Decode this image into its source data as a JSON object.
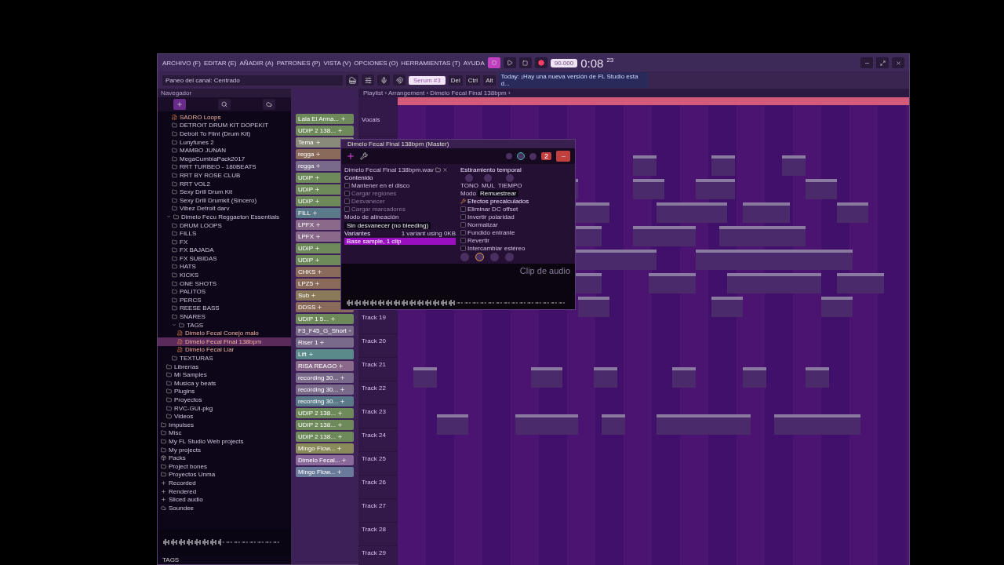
{
  "window": {
    "menu": [
      "ARCHIVO (F)",
      "EDITAR (E)",
      "AÑADIR (A)",
      "PATRONES (P)",
      "VISTA (V)",
      "OPCIONES (O)",
      "HERRAMIENTAS (T)",
      "AYUDA"
    ],
    "recording": true,
    "tempo": "90.000",
    "time": "0:08",
    "time_sub": "23",
    "hint": "Paneo del canal: Centrado",
    "pattern": "Serum #3",
    "keys": [
      "Del",
      "Ctrl",
      "Alt"
    ],
    "news": "Today: ¡Hay una nueva versión de FL Studio esta d..."
  },
  "browser": {
    "title": "Navegador",
    "footer": "TAGS",
    "tree": [
      {
        "kind": "group",
        "children": [
          {
            "kind": "group",
            "children": [
              {
                "kind": "file",
                "label": "SADRO Loops",
                "selected": false
              },
              {
                "kind": "folder",
                "label": "DETROIT DRUM KIT DOPEKIT",
                "selected": false
              },
              {
                "kind": "folder",
                "label": "Detroit To Flint (Drum Kit)",
                "selected": false
              },
              {
                "kind": "folder",
                "label": "Lunyfunes 2",
                "selected": false
              },
              {
                "kind": "folder",
                "label": "MAMBO JUNAN",
                "selected": false
              },
              {
                "kind": "folder",
                "label": "MegaCumbiaPack2017",
                "selected": false
              },
              {
                "kind": "folder",
                "label": "RRT TURBEO - 180BEATS",
                "selected": false
              },
              {
                "kind": "folder",
                "label": "RRT BY ROSE CLUB",
                "selected": false
              },
              {
                "kind": "folder",
                "label": "RRT VOL2",
                "selected": false
              },
              {
                "kind": "folder",
                "label": "Sexy Drill Drum Kit",
                "selected": false
              },
              {
                "kind": "folder",
                "label": "Sexy Drill Drumkit (Sincero)",
                "selected": false
              },
              {
                "kind": "folder",
                "label": "Vibez Detroit darv",
                "selected": false
              }
            ]
          },
          {
            "kind": "folder",
            "label": "Dimelo Fecu Reggaeton Essentials",
            "expanded": true,
            "selected": false,
            "children": [
              {
                "kind": "folder",
                "label": "DRUM LOOPS",
                "selected": false
              },
              {
                "kind": "folder",
                "label": "FILLS",
                "selected": false
              },
              {
                "kind": "folder",
                "label": "FX",
                "selected": false
              },
              {
                "kind": "folder",
                "label": "FX BAJADA",
                "selected": false
              },
              {
                "kind": "folder",
                "label": "FX SUBIDAS",
                "selected": false
              },
              {
                "kind": "folder",
                "label": "HATS",
                "selected": false
              },
              {
                "kind": "folder",
                "label": "KICKS",
                "selected": false
              },
              {
                "kind": "folder",
                "label": "ONE SHOTS",
                "selected": false
              },
              {
                "kind": "folder",
                "label": "PALITOS",
                "selected": false
              },
              {
                "kind": "folder",
                "label": "PERCS",
                "selected": false
              },
              {
                "kind": "folder",
                "label": "REESE BASS",
                "selected": false
              },
              {
                "kind": "folder",
                "label": "SNARES",
                "selected": false
              },
              {
                "kind": "folder",
                "label": "TAGS",
                "expanded": true,
                "selected": false,
                "children": [
                  {
                    "kind": "file",
                    "label": "Dimelo Fecal Conejo malo",
                    "selected": false
                  },
                  {
                    "kind": "file",
                    "label": "Dimelo Fecal Final 138bpm",
                    "selected": true
                  },
                  {
                    "kind": "file",
                    "label": "Dimelo Fecal Liar",
                    "selected": false
                  }
                ]
              },
              {
                "kind": "folder",
                "label": "TEXTURAS",
                "selected": false
              }
            ]
          },
          {
            "kind": "folder",
            "label": "Librerías",
            "selected": false
          },
          {
            "kind": "folder",
            "label": "Mi Samples",
            "selected": false
          },
          {
            "kind": "folder",
            "label": "Musica y beats",
            "selected": false
          },
          {
            "kind": "folder",
            "label": "Plugins",
            "selected": false
          },
          {
            "kind": "folder",
            "label": "Proyectos",
            "selected": false
          },
          {
            "kind": "folder",
            "label": "RVC-GUI-pkg",
            "selected": false
          },
          {
            "kind": "folder",
            "label": "Videos",
            "selected": false
          }
        ]
      },
      {
        "kind": "folder",
        "label": "Impulses",
        "selected": false
      },
      {
        "kind": "folder",
        "label": "Misc",
        "selected": false
      },
      {
        "kind": "folder",
        "label": "My FL Studio Web projects",
        "selected": false
      },
      {
        "kind": "folder",
        "label": "My projects",
        "selected": false
      },
      {
        "kind": "pack",
        "label": "Packs",
        "selected": false
      },
      {
        "kind": "folder",
        "label": "Project bones",
        "selected": false
      },
      {
        "kind": "folder",
        "label": "Proyectos Unma",
        "selected": false
      },
      {
        "kind": "plus",
        "label": "Recorded",
        "selected": false
      },
      {
        "kind": "plus",
        "label": "Rendered",
        "selected": false
      },
      {
        "kind": "plus",
        "label": "Sliced audio",
        "selected": false
      },
      {
        "kind": "cloud",
        "label": "Soundee",
        "selected": false
      }
    ]
  },
  "channels": [
    {
      "name": "Lala El Arma...",
      "color": "#6f8a5a"
    },
    {
      "name": "UDIP 2 138...",
      "color": "#6f8a5a"
    },
    {
      "name": "Tema",
      "color": "#8a8a7a"
    },
    {
      "name": "regga",
      "color": "#8a6a5a"
    },
    {
      "name": "regga",
      "color": "#7a6a8a"
    },
    {
      "name": "UDIP",
      "color": "#6f8a5a"
    },
    {
      "name": "UDIP",
      "color": "#6f8a5a"
    },
    {
      "name": "UDIP",
      "color": "#6f8a5a"
    },
    {
      "name": "FILL",
      "color": "#5a7a8a"
    },
    {
      "name": "LPFX",
      "color": "#8a6a8a"
    },
    {
      "name": "LPFX",
      "color": "#8a6a8a"
    },
    {
      "name": "UDIP",
      "color": "#6f8a5a"
    },
    {
      "name": "UDIP",
      "color": "#6f8a5a"
    },
    {
      "name": "CHKS",
      "color": "#8a6a5a"
    },
    {
      "name": "LPZ5",
      "color": "#8a6a5a"
    },
    {
      "name": "Sub",
      "color": "#8a7a5a"
    },
    {
      "name": "DDSS",
      "color": "#8a6a5a"
    },
    {
      "name": "UDIP 1 5...",
      "color": "#6f8a5a"
    },
    {
      "name": "F3_F45_G_Short",
      "color": "#7a6a8a"
    },
    {
      "name": "Riser 1",
      "color": "#7a6a8a"
    },
    {
      "name": "Lift",
      "color": "#5a8a8a"
    },
    {
      "name": "RISA REAGO",
      "color": "#8a6a8a"
    },
    {
      "name": "recording 30...",
      "color": "#7a6a8a"
    },
    {
      "name": "recording 30...",
      "color": "#7a6a8a"
    },
    {
      "name": "recording 30...",
      "color": "#5a7a8a"
    },
    {
      "name": "UDIP 2 138...",
      "color": "#6f8a5a"
    },
    {
      "name": "UDIP 2 138...",
      "color": "#6f8a5a"
    },
    {
      "name": "UDIP 2 138...",
      "color": "#6f8a5a"
    },
    {
      "name": "Mingo Flow...",
      "color": "#8a8a5a"
    },
    {
      "name": "Dimelo Fecal...",
      "color": "#8a6a9a"
    },
    {
      "name": "Mingo Flow...",
      "color": "#6a7a9a"
    }
  ],
  "playlist": {
    "breadcrumb": "Playlist › Arrangement › Dimelo Fecal Final 138bpm ›",
    "tracks_top": [
      {
        "label": "Vocals"
      }
    ],
    "tracks": [
      {
        "label": "Track 19"
      },
      {
        "label": "Track 20"
      },
      {
        "label": "Track 21"
      },
      {
        "label": "Track 22"
      },
      {
        "label": "Track 23"
      },
      {
        "label": "Track 24"
      },
      {
        "label": "Track 25"
      },
      {
        "label": "Track 26"
      },
      {
        "label": "Track 27"
      },
      {
        "label": "Track 28"
      },
      {
        "label": "Track 29"
      }
    ]
  },
  "plugin": {
    "title": "Dimelo Fecal Final 138bpm (Master)",
    "track": "2",
    "sample": "Dimelo Fecal Final 138bpm.wav",
    "content_title": "Contenido",
    "content_options": [
      {
        "label": "Mantener en el disco",
        "checked": false,
        "disabled": false
      },
      {
        "label": "Cargar regiones",
        "checked": false,
        "disabled": true
      },
      {
        "label": "Desvanecer",
        "checked": false,
        "disabled": true
      },
      {
        "label": "Cargar marcadores",
        "checked": false,
        "disabled": true
      }
    ],
    "align_label": "Modo de alineación",
    "align_value": "Sin desvanecer (no bleeding)",
    "variants_title": "Variantes",
    "variants_info": "1 variant using 0KB",
    "variants": [
      {
        "label": "Base sample, 1 clip",
        "selected": true
      }
    ],
    "stretch_title": "Estiramiento temporal",
    "stretch_knobs": [
      "TONO",
      "MUL",
      "TIEMPO"
    ],
    "mode_label": "Modo",
    "mode_value": "Remuestrear",
    "effects_title": "Efectos precalculados",
    "effects": [
      {
        "label": "Eliminar DC offset",
        "checked": false
      },
      {
        "label": "Invertir polaridad",
        "checked": false
      },
      {
        "label": "Normalizar",
        "checked": false
      },
      {
        "label": "Fundido entrante",
        "checked": false
      },
      {
        "label": "Revertir",
        "checked": false
      },
      {
        "label": "Intercambiar estéreo",
        "checked": false
      }
    ],
    "clip_label": "Clip de audio"
  }
}
